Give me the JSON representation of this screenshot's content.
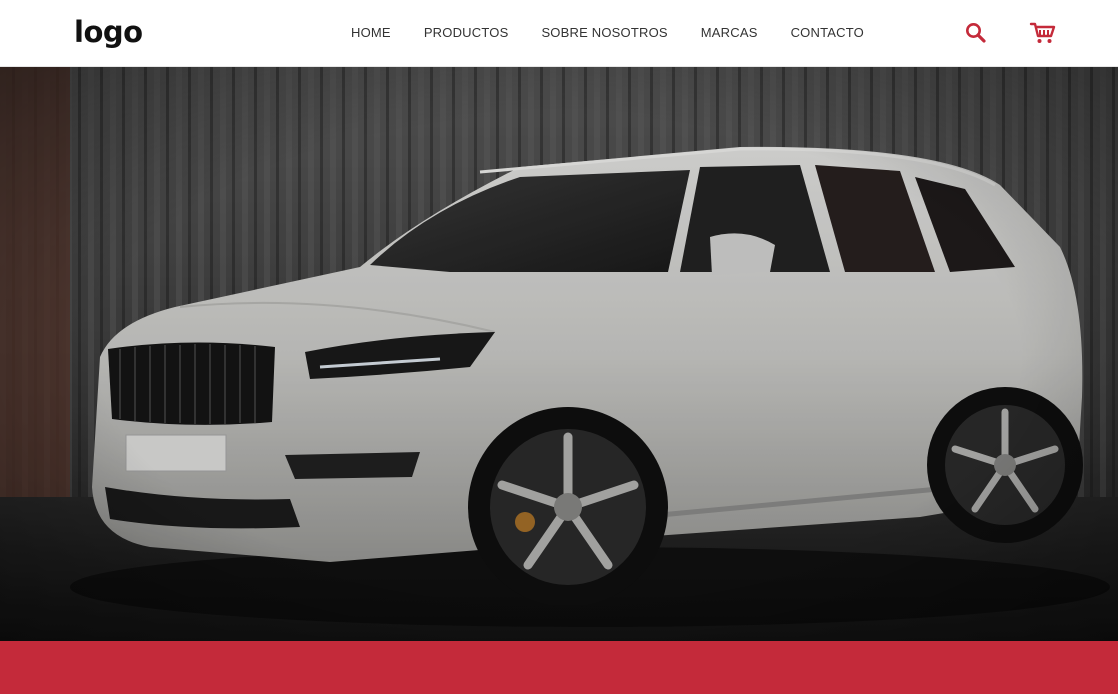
{
  "header": {
    "logo_text": "logo",
    "nav": [
      {
        "label": "HOME"
      },
      {
        "label": "PRODUCTOS"
      },
      {
        "label": "SOBRE NOSOTROS"
      },
      {
        "label": "MARCAS"
      },
      {
        "label": "CONTACTO"
      }
    ],
    "icons": {
      "search": "search-icon",
      "cart": "cart-icon"
    }
  },
  "hero": {
    "image": "white SUV parked in front of corrugated metal wall"
  },
  "colors": {
    "accent": "#c42a3a",
    "nav_text": "#333333",
    "logo_text": "#111111"
  }
}
